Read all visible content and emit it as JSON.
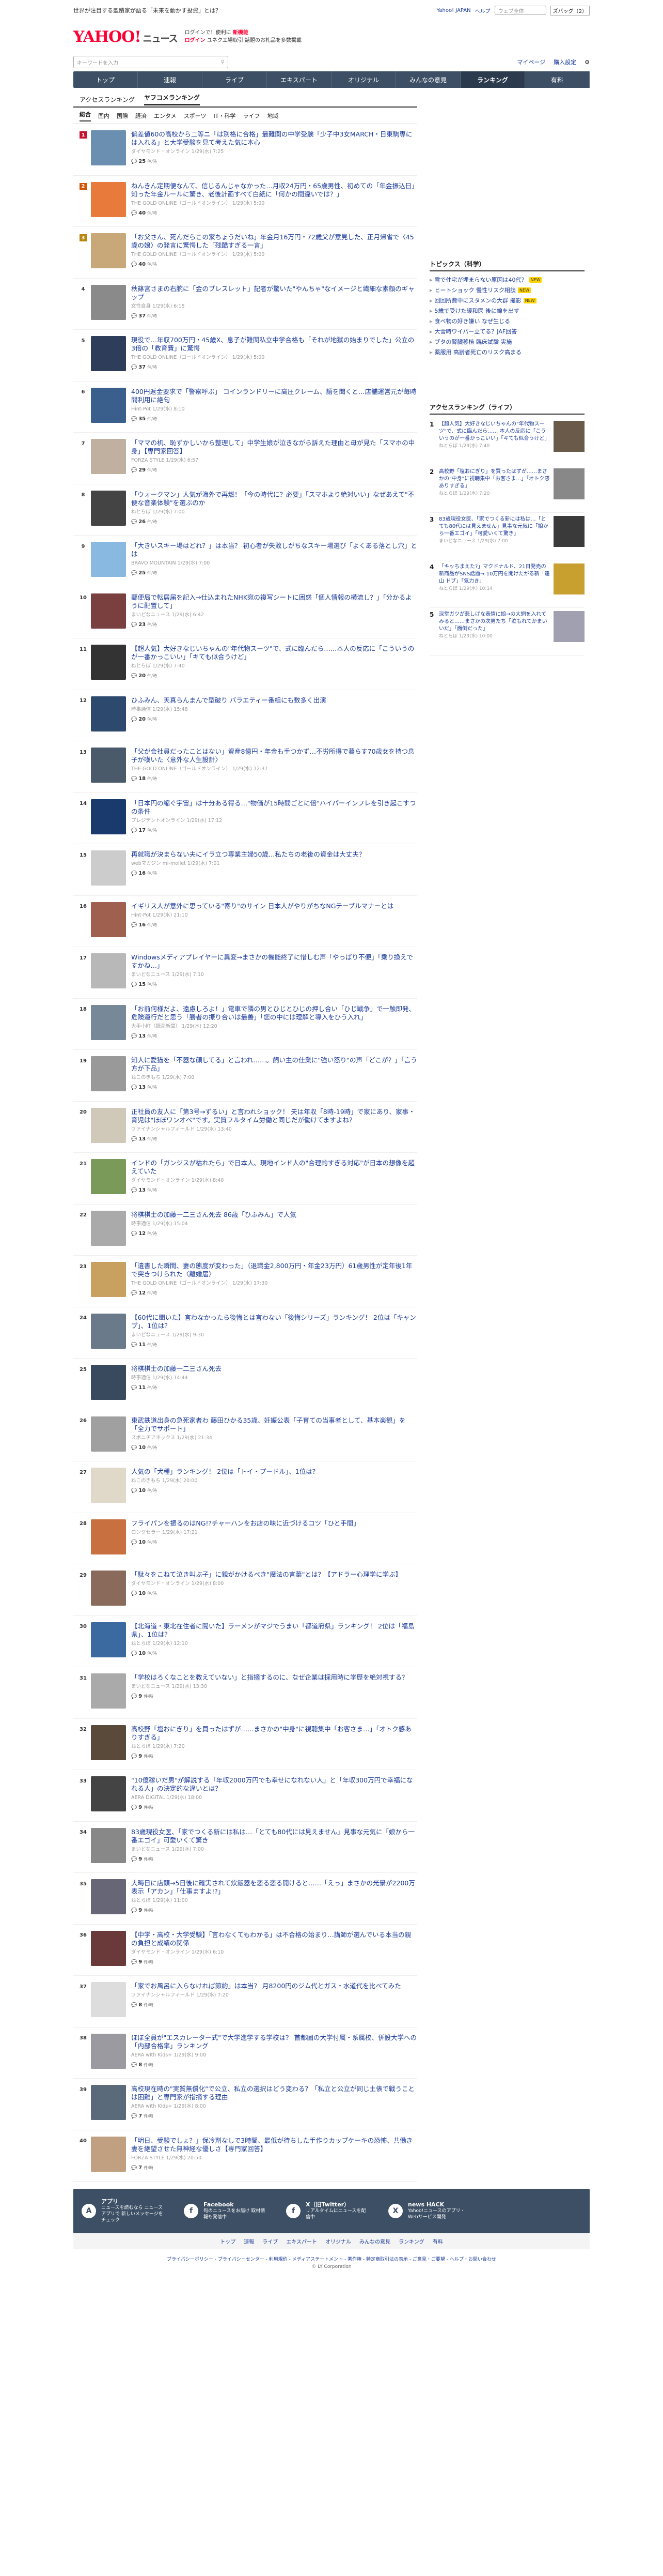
{
  "topbar": {
    "promo": "世界が注目する聖蹟家が語る「未来を動かす投資」とは？",
    "links": [
      "Yahoo! JAPAN",
      "ヘルプ"
    ],
    "search_placeholder": "ウェブ全体",
    "search_btn": "ズバッグ（2）"
  },
  "header": {
    "logo": "YAHOO!",
    "logo_sub": "ニュース",
    "logo_jp": "JAPAN",
    "tag1": "ログインで！便利に",
    "tag1b": "新機能",
    "tag2": "ログイン",
    "tag3": "ユネク工場取引 話題のお札品を多数掲載"
  },
  "searchbar": {
    "placeholder": "キーワードを入力",
    "mypage": "マイページ",
    "subscribe": "購入設定"
  },
  "gnav": [
    "トップ",
    "速報",
    "ライブ",
    "エキスパート",
    "オリジナル",
    "みんなの意見",
    "ランキング",
    "有料"
  ],
  "tabs1": [
    "アクセスランキング",
    "ヤフコメランキング"
  ],
  "tabs2": [
    "総合",
    "国内",
    "国際",
    "経済",
    "エンタメ",
    "スポーツ",
    "IT・科学",
    "ライフ",
    "地域"
  ],
  "ranking": [
    {
      "n": "1",
      "title": "偏差値60の高校から二等ニ「は別格に合格」最難関の中学受験「少子中3女MARCH・日東駒専には入れる」と大学受験を見て考えた気に本心",
      "meta": "ダイヤモンド・オンライン 1/29(水) 7:25",
      "com": "25",
      "unit": "件/時"
    },
    {
      "n": "2",
      "title": "ねんきん定期便なんて、信じるんじゃなかった…月収24万円・65歳男性、初めての「年金振込日」知った年金ルールに驚き、老後計画すべて白紙に「何かの間違いでは？」",
      "meta": "THE GOLD ONLINE（ゴールドオンライン） 1/29(水) 5:00",
      "com": "40",
      "unit": "件/時"
    },
    {
      "n": "3",
      "title": "「お父さん、死んだらこの家ちょうだいね」年金月16万円・72歳父が意見した、正月帰省で〈45歳の娘〉の発言に驚愕した「残酷すぎる一言」",
      "meta": "THE GOLD ONLINE（ゴールドオンライン） 1/29(水) 5:00",
      "com": "40",
      "unit": "件/時"
    },
    {
      "n": "4",
      "title": "秋篠宮さまの右腕に「金のブレスレット」記者が驚いた\"やんちゃ\"なイメージと繊細な素顔のギャップ",
      "meta": "女性自身 1/29(水) 6:15",
      "com": "37",
      "unit": "件/時"
    },
    {
      "n": "5",
      "title": "現役で…年収700万円・45歳X、息子が難関私立中学合格も「それが地獄の始まりでした」公立の3倍の「教育費」に驚愕",
      "meta": "THE GOLD ONLINE（ゴールドオンライン） 1/29(水) 5:00",
      "com": "37",
      "unit": "件/時"
    },
    {
      "n": "6",
      "title": "400円返金要求で「警察呼ぶ」 コインランドリーに高圧クレーム、語を聞くと…店舗運営元が毎時間利用に絶句",
      "meta": "Hint-Pot 1/29(水) 8:10",
      "com": "35",
      "unit": "件/時"
    },
    {
      "n": "7",
      "title": "「ママの机、恥ずかしいから整理して」中学生娘が泣きながら訴えた理由と母が見た「スマホの中身」【専門家回答】",
      "meta": "FORZA STYLE 1/29(水) 6:57",
      "com": "29",
      "unit": "件/時"
    },
    {
      "n": "8",
      "title": "「ウォークマン」人気が海外で再燃！「今の時代に？必要」「スマホより絶対いい」なぜあえて\"不便な音楽体験\"を選ぶのか",
      "meta": "ねとらぼ 1/29(水) 7:00",
      "com": "26",
      "unit": "件/時"
    },
    {
      "n": "9",
      "title": "「大きいスキー場はどれ？」は本当？ 初心者が失敗しがちなスキー場選び「よくある落とし穴」とは",
      "meta": "BRAVO MOUNTAIN 1/29(水) 7:00",
      "com": "25",
      "unit": "件/時"
    },
    {
      "n": "10",
      "title": "郵便局で転居届を記入→仕込まれたNHK宛の複写シートに困惑「個人情報の横流し？」「分かるように配置して」",
      "meta": "まいどなニュース 1/29(水) 6:42",
      "com": "23",
      "unit": "件/時"
    },
    {
      "n": "11",
      "title": "【超人気】大好きなじいちゃんの\"年代物スーツ\"で、式に臨んだら……本人の反応に「こういうのが一番かっこいい」「キても似合うけど」",
      "meta": "ねとらぼ 1/29(水) 7:40",
      "com": "20",
      "unit": "件/時"
    },
    {
      "n": "12",
      "title": "ひふみん、天真らんまんで型破り バラエティー番組にも数多く出演",
      "meta": "時事通信 1/29(水) 15:48",
      "com": "20",
      "unit": "件/時"
    },
    {
      "n": "13",
      "title": "「父が会社員だったことはない」資産8億円・年金も手つかず…不労所得で暮らす70歳女を持つ息子が嘆いた〈意外な人生設計〉",
      "meta": "THE GOLD ONLINE（ゴールドオンライン） 1/29(水) 12:37",
      "com": "18",
      "unit": "件/時"
    },
    {
      "n": "14",
      "title": "「日本円の縮ぐ宇宙」は十分ある得る…\"物価が15時間ごとに倍\"ハイパーインフレを引き起こすつの条件",
      "meta": "プレジデントオンライン 1/29(水) 17:12",
      "com": "17",
      "unit": "件/時"
    },
    {
      "n": "15",
      "title": "再就職が決まらない夫にイラ立つ専業主婦50歳…私たちの老後の資金は大丈夫？",
      "meta": "webマガジン mi-mollet 1/29(水) 7:01",
      "com": "16",
      "unit": "件/時"
    },
    {
      "n": "16",
      "title": "イギリス人が意外に思っている\"寄り\"のサイン 日本人がやりがちなNGテーブルマナーとは",
      "meta": "Hint-Pot 1/29(水) 21:10",
      "com": "16",
      "unit": "件/時"
    },
    {
      "n": "17",
      "title": "Windowsメディアプレイヤーに異変→まさかの機能終了に惜しむ声「やっぱり不便」「乗り換えですかね…」",
      "meta": "まいどなニュース 1/29(水) 7:10",
      "com": "15",
      "unit": "件/時"
    },
    {
      "n": "18",
      "title": "「お前何様だよ、遠慮しろよ！」電車で隣の男とひじとひじの押し合い「ひじ戦争」で一触即発、危険運行だと思う「勝者の振り合いは最善」「您の中には理解と導入をひう入れ」",
      "meta": "大手小町（読売新聞） 1/29(水) 12:20",
      "com": "13",
      "unit": "件/時"
    },
    {
      "n": "19",
      "title": "知人に愛猫を「不器な顔してる」と言われ……。飼い主の仕業に\"強い怒り\"の声「どこが？」「言う方が下品」",
      "meta": "ねこのきもち 1/29(水) 7:00",
      "com": "13",
      "unit": "件/時"
    },
    {
      "n": "20",
      "title": "正社員の友人に「第3号→ずるい」と言われショック！ 夫は年収「8時-19時」で家にあり、家事・育児は\"ほぼワンオペ\"です。実質フルタイム労働と同じだが働けてますよね？",
      "meta": "ファイナンシャルフィールド 1/29(水) 13:40",
      "com": "13",
      "unit": "件/時"
    },
    {
      "n": "21",
      "title": "インドの「ガンジスが枯れたら」で日本人、現地インド人の\"合理的すぎる対応\"が日本の想像を超えていた",
      "meta": "ダイヤモンド・オンライン 1/29(水) 8:40",
      "com": "13",
      "unit": "件/時"
    },
    {
      "n": "22",
      "title": "将棋棋士の加藤一二三さん死去 86歳「ひふみん」で人気",
      "meta": "時事通信 1/29(水) 15:04",
      "com": "12",
      "unit": "件/時"
    },
    {
      "n": "23",
      "title": "「遺書した瞬間、妻の態度が変わった」（退職金2,800万円・年金23万円）61歳男性が定年後1年で突きつけられた〈離婚届〉",
      "meta": "THE GOLD ONLINE（ゴールドオンライン） 1/29(水) 17:30",
      "com": "12",
      "unit": "件/時"
    },
    {
      "n": "24",
      "title": "【60代に聞いた】言わなかったら後悔とは言わない「後悔シリーズ」ランキング！ 2位は「キャンプ」、1位は？",
      "meta": "まいどなニュース 1/29(水) 9:30",
      "com": "11",
      "unit": "件/時"
    },
    {
      "n": "25",
      "title": "将棋棋士の加藤一二三さん死去",
      "meta": "時事通信 1/29(水) 14:44",
      "com": "11",
      "unit": "件/時"
    },
    {
      "n": "26",
      "title": "東武鉄道出身の急死家者わ 藤田ひかる35歳、妊娠公表「子育ての当事者として、基本楽観」を「全力でサポート」",
      "meta": "スポニチアネックス 1/29(水) 21:34",
      "com": "10",
      "unit": "件/時"
    },
    {
      "n": "27",
      "title": "人気の「犬種」ランキング！ 2位は「トイ・プードル」、1位は？",
      "meta": "ねこのきもち 1/29(水) 20:00",
      "com": "10",
      "unit": "件/時"
    },
    {
      "n": "28",
      "title": "フライパンを振るのはNG!?チャーハンをお店の味に近づけるコツ「ひと手間」",
      "meta": "ロングセラー 1/29(水) 17:21",
      "com": "10",
      "unit": "件/時"
    },
    {
      "n": "29",
      "title": "「駄々をこねて泣き叫ぶ子」に親がかけるべき\"魔法の言葉\"とは？【アドラー心理学に学ぶ】",
      "meta": "ダイヤモンド・オンライン 1/29(水) 8:00",
      "com": "10",
      "unit": "件/時"
    },
    {
      "n": "30",
      "title": "【北海道・東北在住者に聞いた】ラーメンがマジでうまい「都道府県」ランキング！ 2位は「福島県」、1位は？",
      "meta": "ねとらぼ 1/29(水) 12:10",
      "com": "10",
      "unit": "件/時"
    },
    {
      "n": "31",
      "title": "「学校はろくなことを教えていない」と指摘するのに、なぜ企業は採用時に学歴を絶対視する？",
      "meta": "まいどなニュース 1/29(水) 13:30",
      "com": "9",
      "unit": "件/時"
    },
    {
      "n": "32",
      "title": "高校野「塩おにぎり」を買ったはずが……まさかの\"中身\"に視聴集中「お客さま…」「オトク感ありすぎる」",
      "meta": "ねとらぼ 1/29(水) 7:20",
      "com": "9",
      "unit": "件/時"
    },
    {
      "n": "33",
      "title": "\"10億稼いだ男\"が解説する「年収2000万円でも幸せになれない人」と「年収300万円で幸福になれる人」の決定的な違いとは？",
      "meta": "AERA DIGITAL 1/29(水) 18:00",
      "com": "9",
      "unit": "件/時"
    },
    {
      "n": "34",
      "title": "83歳現役女医、「家でつくる新には私は…「とても80代には見えません」見事な元気に「娘から一番エゴイ」可愛いくて驚き",
      "meta": "まいどなニュース 1/29(水) 7:00",
      "com": "9",
      "unit": "件/時"
    },
    {
      "n": "35",
      "title": "大晦日に店頭→5日後に確実されて炊飯器を恋る恋る開けると……「えっ」まさかの光景が2200万表示「アカン」「仕事ますよ!?」",
      "meta": "ねとらぼ 1/29(水) 11:00",
      "com": "9",
      "unit": "件/時"
    },
    {
      "n": "36",
      "title": "【中学・高校・大学受験】「言わなくてもわかる」は不合格の始まり…講師が選んでいる本当の親の負担と成績の関係",
      "meta": "ダイヤモンド・オンライン 1/29(水) 6:10",
      "com": "9",
      "unit": "件/時"
    },
    {
      "n": "37",
      "title": "「家でお風呂に入らなければ節約」は本当？ 月8200円のジム代とガス・水道代を比べてみた",
      "meta": "ファイナンシャルフィールド 1/29(水) 7:20",
      "com": "8",
      "unit": "件/時"
    },
    {
      "n": "38",
      "title": "ほぼ全員が\"エスカレーター式\"で大学進学する学校は？ 首都圏の大学付属・系属校、併設大学への「内部合格率」ランキング",
      "meta": "AERA with Kids+ 1/29(水) 9:00",
      "com": "8",
      "unit": "件/時"
    },
    {
      "n": "39",
      "title": "高校現在時の\"実質無償化\"で公立、私立の選択はどう変わる？「私立と公立が同じ土俵で戦うことは困難」と専門家が指摘する理由",
      "meta": "AERA with Kids+ 1/29(水) 8:00",
      "com": "7",
      "unit": "件/時"
    },
    {
      "n": "40",
      "title": "「明日、受験でしょ？」保冷剤なしで3時間、最低が待ちした手作りカップケーキの恐怖、共働き妻を絶望させた無神経な優しさ【専門家回答】",
      "meta": "FORZA STYLE 1/29(水) 20:50",
      "com": "7",
      "unit": "件/時"
    }
  ],
  "side": {
    "topics_title": "トピックス（科学）",
    "topics": [
      {
        "t": "雪で住宅が埋まらない原因は40代？",
        "b": "NEW"
      },
      {
        "t": "ヒートショック 慢性リスク相談",
        "b": "NEW"
      },
      {
        "t": "回回所費中にスタメンの大群 撮影",
        "b": "NEW"
      },
      {
        "t": "5歳で受けた緩和医 後に線を出す",
        "b": ""
      },
      {
        "t": "食べ物の好き嫌い なぜ生じる",
        "b": ""
      },
      {
        "t": "大雪時ワイパー立てる？JAF回答",
        "b": ""
      },
      {
        "t": "ブタの腎臓移植 臨床試験 実施",
        "b": ""
      },
      {
        "t": "薬服用 高齢者死亡のリスク高まる",
        "b": ""
      }
    ],
    "life_title": "アクセスランキング（ライフ）",
    "life": [
      {
        "n": "1",
        "t": "【超人気】大好きなじいちゃんの\"年代物スーツ\"で、式に臨んだら…… 本人の反応に「こういうのが一番かっこいい」「キても似合うけど」",
        "m": "ねとらぼ 1/29(水) 7:40"
      },
      {
        "n": "2",
        "t": "高校野「塩おにぎり」を買ったはずが……まさかの\"中身\"に視聴集中「お客さま…」「オトク感ありすぎる」",
        "m": "ねとらぼ 1/29(水) 7:20"
      },
      {
        "n": "3",
        "t": "83歳現役女医、「家でつくる新には私は…「とても80代には見えません」見事な元気に「娘から一番エゴイ」「可愛いくて驚き」",
        "m": "まいどなニュース 1/29(水) 7:00"
      },
      {
        "n": "4",
        "t": "「キッちまえた?」マクドナルド、21日発売の新商品がSNS話題→ 10万円を開けたがる新「遠山 ドブ」「気力き」",
        "m": "ねとらぼ 1/29(水) 10:14"
      },
      {
        "n": "5",
        "t": "深堂ガツが悲しげな表情に娘→の大網を入れてみると……まさかの次男たち「泣もれてかまいいだ」「面倒だった」",
        "m": "ねとらぼ 1/29(水) 10:00"
      }
    ]
  },
  "footer": {
    "cols": [
      {
        "icon": "A",
        "title": "アプリ",
        "sub": "ニュースを読むなら ニュースアプリで 新しいメッセージをチェック"
      },
      {
        "icon": "f",
        "title": "Facebook",
        "sub": "旬のニュースをお届け 取材情報も発信中"
      },
      {
        "icon": "f",
        "title": "X（旧Twitter）",
        "sub": "リアルタイムにニュースを配信中"
      },
      {
        "icon": "X",
        "title": "news HACK",
        "sub": "Yahoo!ニュースのアプリ・Webサービス開発"
      }
    ],
    "nav": [
      "トップ",
      "速報",
      "ライブ",
      "エキスパート",
      "オリジナル",
      "みんなの意見",
      "ランキング",
      "有料"
    ],
    "links": "プライバシーポリシー - プライバシーセンター - 利用規約 - メディアステートメント - 著作権 - 特定商取引法の表示 - ご意見・ご要望 - ヘルプ・お問い合わせ",
    "copy": "© LY Corporation"
  }
}
